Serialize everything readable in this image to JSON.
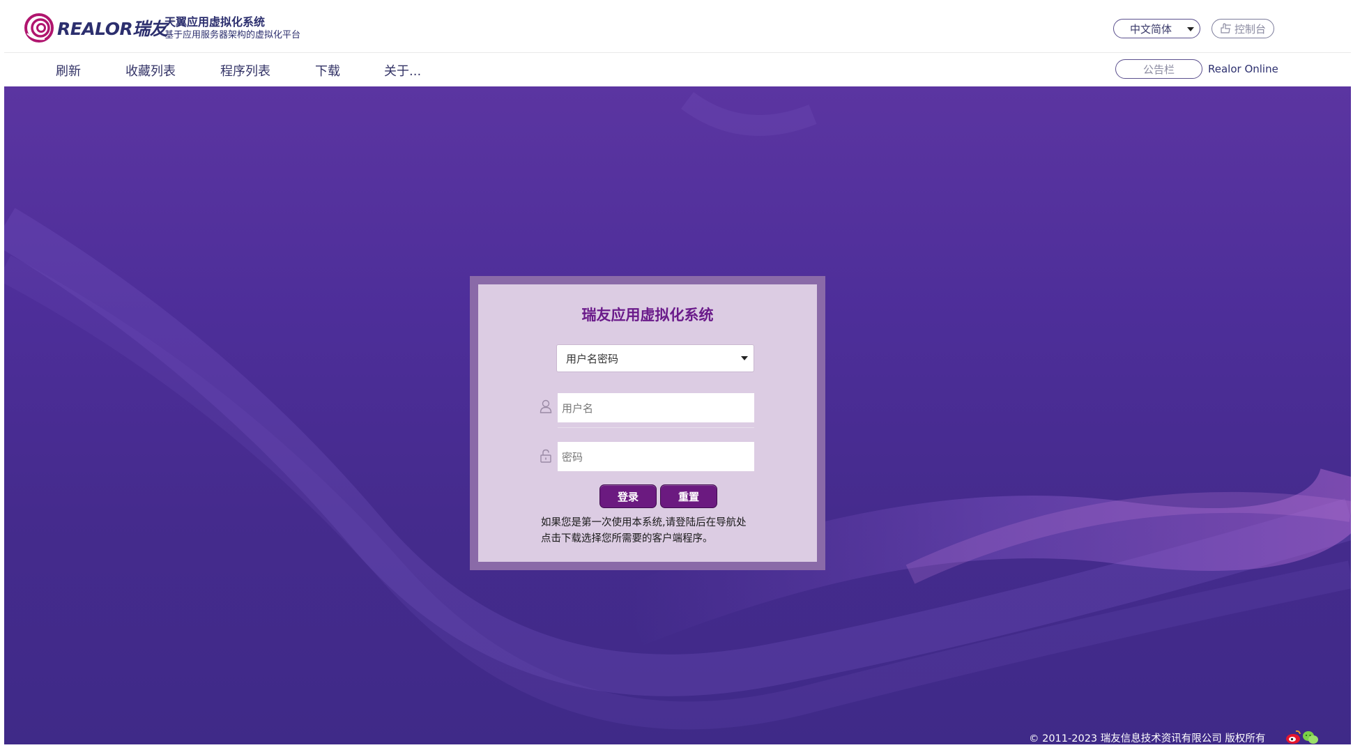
{
  "header": {
    "logo_text": "REALOR瑞友",
    "logo_reg": "®",
    "system_title": "天翼应用虚拟化系统",
    "system_subtitle": "基于应用服务器架构的虚拟化平台",
    "language": "中文简体",
    "console_label": "控制台"
  },
  "nav": {
    "items": [
      {
        "label": "刷新"
      },
      {
        "label": "收藏列表"
      },
      {
        "label": "程序列表"
      },
      {
        "label": "下载"
      },
      {
        "label": "关于..."
      }
    ],
    "notice_label": "公告栏",
    "realor_online": "Realor Online"
  },
  "login": {
    "title": "瑞友应用虚拟化系统",
    "auth_method": "用户名密码",
    "username_placeholder": "用户名",
    "password_placeholder": "密码",
    "login_button": "登录",
    "reset_button": "重置",
    "hint_line1": "如果您是第一次使用本系统,请登陆后在导航处",
    "hint_line2": "点击下载选择您所需要的客户端程序。"
  },
  "footer": {
    "copyright": "© 2011-2023 瑞友信息技术资讯有限公司 版权所有"
  },
  "colors": {
    "brand_navy": "#2c2f6e",
    "login_title": "#6a1a8a",
    "button": "#6b1a80",
    "background_top": "#5b35a1",
    "background_bottom": "#3f2a88"
  },
  "icons": [
    "logo-swirl",
    "hand-pointer-icon",
    "user-icon",
    "lock-icon",
    "weibo-icon",
    "wechat-icon",
    "chevron-down-icon"
  ]
}
